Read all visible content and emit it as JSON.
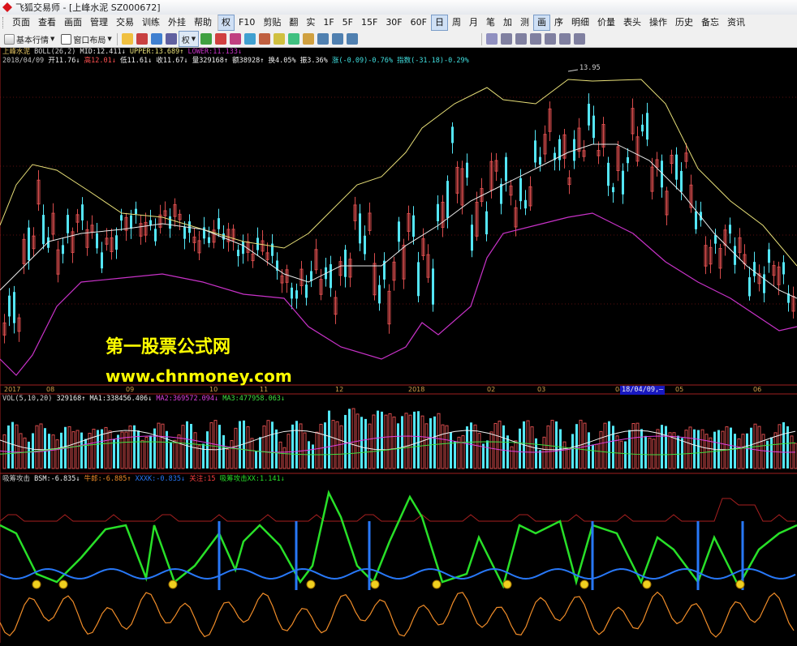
{
  "window": {
    "title": "飞狐交易师 - [上峰水泥 SZ000672]"
  },
  "menu": [
    {
      "label": "页面"
    },
    {
      "label": "查看"
    },
    {
      "label": "画面"
    },
    {
      "label": "管理"
    },
    {
      "label": "交易"
    },
    {
      "label": "训练"
    },
    {
      "label": "外挂"
    },
    {
      "label": "帮助"
    },
    {
      "label": "权",
      "active": true
    },
    {
      "label": "F10"
    },
    {
      "label": "剪贴"
    },
    {
      "label": "翻"
    },
    {
      "label": "实"
    },
    {
      "label": "1F"
    },
    {
      "label": "5F"
    },
    {
      "label": "15F"
    },
    {
      "label": "30F"
    },
    {
      "label": "60F"
    },
    {
      "label": "日",
      "active": true
    },
    {
      "label": "周"
    },
    {
      "label": "月"
    },
    {
      "label": "笔"
    },
    {
      "label": "加"
    },
    {
      "label": "测"
    },
    {
      "label": "画",
      "active": true
    },
    {
      "label": "序"
    },
    {
      "label": "明细"
    },
    {
      "label": "价量"
    },
    {
      "label": "表头"
    },
    {
      "label": "操作"
    },
    {
      "label": "历史"
    },
    {
      "label": "备忘"
    },
    {
      "label": "资讯"
    }
  ],
  "toolbar": {
    "basic_market": "基本行情",
    "window_layout": "窗口布局",
    "quan": "权"
  },
  "stock_name": "上峰水泥",
  "boll": {
    "label": "BOLL(26,2)",
    "mid": "MID:12.411↓",
    "upper": "UPPER:13.689↑",
    "lower": "LOWER:11.133↓"
  },
  "quote": {
    "date": "2018/04/09",
    "open": "开11.76↓",
    "high": "高12.01↓",
    "low": "低11.61↓",
    "close": "收11.67↓",
    "volume": "量329168↑",
    "amount": "额38928↑",
    "turnover": "换4.05%",
    "amplitude": "振3.36%",
    "change": "涨(-0.09)-0.76%",
    "index": "指数(-31.18)-0.29%"
  },
  "price_marker": "13.95",
  "watermark": {
    "line1": "第一股票公式网",
    "line2": "www.chnmoney.com"
  },
  "time_axis": {
    "labels": [
      "2017",
      "08",
      "09",
      "10",
      "11",
      "12",
      "2018",
      "02",
      "03",
      "04",
      "05",
      "06"
    ],
    "cursor_date": "18/04/09,—"
  },
  "vol": {
    "label": "VOL(5,10,20)",
    "value": "329168↑",
    "ma1": "MA1:338456.406↓",
    "ma2": "MA2:369572.094↓",
    "ma3": "MA3:477958.063↓"
  },
  "indicator": {
    "name": "吸筹攻击",
    "bsm": "BSM:-6.835↓",
    "niuma": "牛郎:-6.885↑",
    "xxxk": "XXXK:-0.835↓",
    "guanzhu": "关注:15",
    "xx": "吸筹攻击XX:1.141↓"
  },
  "colors": {
    "boll_upper": "#e8e078",
    "boll_mid": "#e8e8e8",
    "boll_lower": "#c832c8",
    "candle_up": "#d84c4c",
    "candle_down": "#54e6f6",
    "ma1": "#f0f0f0",
    "ma2": "#e040e0",
    "ma3": "#40e040",
    "green_line": "#28e028",
    "blue_line": "#2878f8",
    "orange_line": "#f08c28",
    "top_line": "#a82020"
  }
}
